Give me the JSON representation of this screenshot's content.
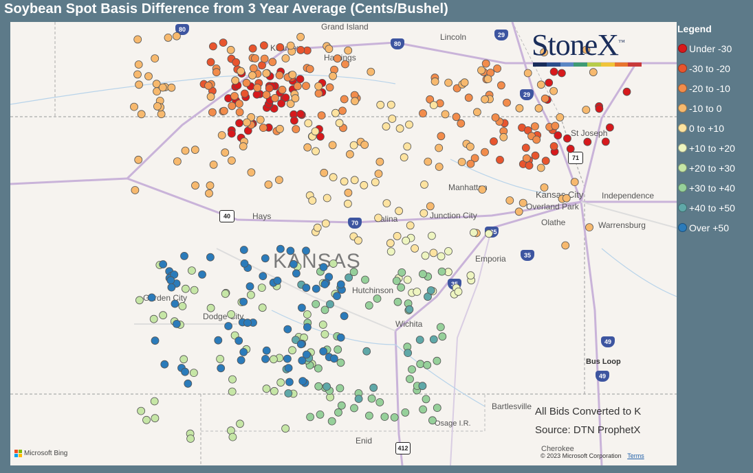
{
  "title": "Soybean Spot Basis Difference from 3 Year Average (Cents/Bushel)",
  "legend": {
    "title": "Legend",
    "items": [
      {
        "label": "Under -30",
        "color": "#d7191c"
      },
      {
        "label": "-30 to -20",
        "color": "#e8552e"
      },
      {
        "label": "-20 to -10",
        "color": "#f28c4b"
      },
      {
        "label": "-10 to 0",
        "color": "#f7b96e"
      },
      {
        "label": "0 to +10",
        "color": "#fde3a0"
      },
      {
        "label": "+10 to +20",
        "color": "#eef5c0"
      },
      {
        "label": "+20 to +30",
        "color": "#c6e6a6"
      },
      {
        "label": "+30 to +40",
        "color": "#96d09a"
      },
      {
        "label": "+40 to +50",
        "color": "#5fa8a8"
      },
      {
        "label": "Over +50",
        "color": "#2b7bba"
      }
    ]
  },
  "map": {
    "state_label": "KANSAS",
    "cities": [
      "Grand Island",
      "Kearney",
      "Hastings",
      "Lincoln",
      "St Joseph",
      "Manhattan",
      "Kansas City",
      "Independence",
      "Overland Park",
      "Olathe",
      "Warrensburg",
      "Hays",
      "Salina",
      "Junction City",
      "Emporia",
      "Hutchinson",
      "Garden City",
      "Dodge City",
      "Wichita",
      "Bartlesville",
      "Osage I.R.",
      "Enid",
      "Cherokee",
      "Bus Loop"
    ],
    "highways": [
      "80",
      "80",
      "29",
      "29",
      "71",
      "40",
      "70",
      "335",
      "35",
      "35",
      "49",
      "49",
      "412"
    ]
  },
  "brand": {
    "logo_text": "StoneX",
    "trademark": "™"
  },
  "notes": {
    "line1": "All Bids Converted to K",
    "line2": "Source: DTN ProphetX"
  },
  "attribution": {
    "bing": "Microsoft Bing",
    "copyright": "© 2023 Microsoft Corporation",
    "terms": "Terms"
  },
  "points": [
    {
      "c": 1,
      "n": 44
    },
    {
      "c": 1,
      "n": 14
    },
    {
      "c": 2,
      "n": 18
    },
    {
      "c": 2,
      "n": 14
    },
    {
      "c": 3,
      "n": 44
    },
    {
      "c": 3,
      "n": 30
    },
    {
      "c": 4,
      "n": 70
    },
    {
      "c": 4,
      "n": 40
    },
    {
      "c": 5,
      "n": 40
    },
    {
      "c": 6,
      "n": 20
    },
    {
      "c": 7,
      "n": 55
    },
    {
      "c": 8,
      "n": 55
    },
    {
      "c": 9,
      "n": 20
    },
    {
      "c": 10,
      "n": 70
    }
  ]
}
